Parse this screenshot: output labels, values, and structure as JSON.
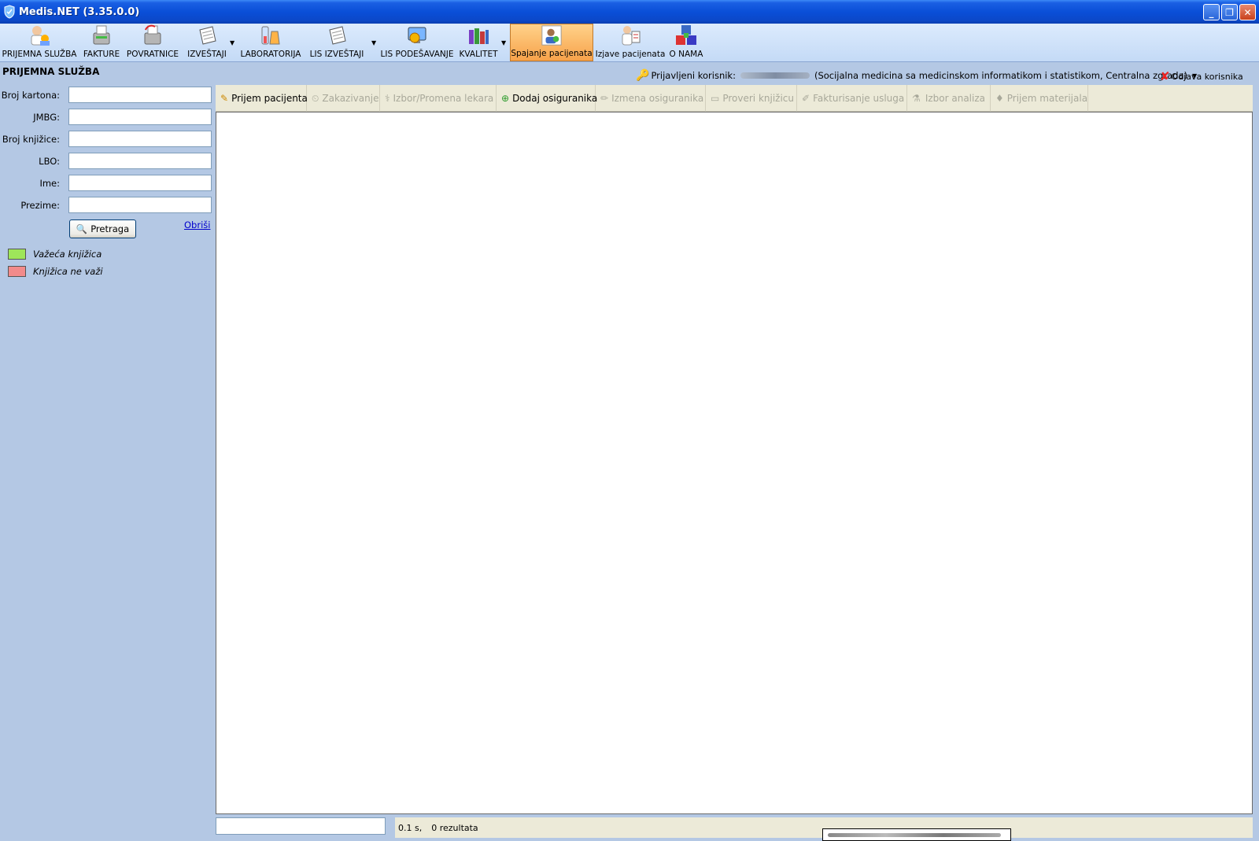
{
  "window": {
    "title": "Medis.NET (3.35.0.0)"
  },
  "toolbar": {
    "items": [
      {
        "label": "PRIJEMNA SLUŽBA",
        "icon": "reception-icon"
      },
      {
        "label": "FAKTURE",
        "icon": "invoice-icon"
      },
      {
        "label": "POVRATNICE",
        "icon": "return-icon"
      },
      {
        "label": "IZVEŠTAJI",
        "icon": "reports-icon"
      },
      {
        "label": "LABORATORIJA",
        "icon": "laboratory-icon"
      },
      {
        "label": "LIS IZVEŠTAJI",
        "icon": "lis-reports-icon"
      },
      {
        "label": "LIS PODEŠAVANJE",
        "icon": "lis-settings-icon"
      },
      {
        "label": "KVALITET",
        "icon": "quality-icon"
      },
      {
        "label": "Spajanje pacijenata",
        "icon": "merge-patients-icon"
      },
      {
        "label": "Izjave pacijenata",
        "icon": "patient-statements-icon"
      },
      {
        "label": "O NAMA",
        "icon": "about-icon"
      }
    ]
  },
  "header": {
    "section_title": "PRIJEMNA SLUŽBA",
    "logged_user_label": "Prijavljeni korisnik:",
    "user_org": "(Socijalna medicina sa medicinskom informatikom i statistikom, Centralna zgrada)",
    "logout_label": "Odjava korisnika"
  },
  "search_form": {
    "fields": [
      {
        "label": "Broj kartona:",
        "value": ""
      },
      {
        "label": "JMBG:",
        "value": ""
      },
      {
        "label": "Broj knjižice:",
        "value": ""
      },
      {
        "label": "LBO:",
        "value": ""
      },
      {
        "label": "Ime:",
        "value": ""
      },
      {
        "label": "Prezime:",
        "value": ""
      }
    ],
    "search_button": "Pretraga",
    "clear_link": "Obriši"
  },
  "legend": [
    {
      "label": "Važeća knjižica",
      "color": "#9ee65a"
    },
    {
      "label": "Knjižica ne važi",
      "color": "#f28b8b"
    }
  ],
  "actions": [
    {
      "label": "Prijem pacijenta",
      "enabled": true
    },
    {
      "label": "Zakazivanje",
      "enabled": false
    },
    {
      "label": "Izbor/Promena lekara",
      "enabled": false
    },
    {
      "label": "Dodaj osiguranika",
      "enabled": true
    },
    {
      "label": "Izmena osiguranika",
      "enabled": false
    },
    {
      "label": "Proveri knjižicu",
      "enabled": false
    },
    {
      "label": "Fakturisanje usluga",
      "enabled": false
    },
    {
      "label": "Izbor analiza",
      "enabled": false
    },
    {
      "label": "Prijem materijala",
      "enabled": false
    }
  ],
  "status": {
    "time": "0.1 s,",
    "results": "0 rezultata"
  }
}
